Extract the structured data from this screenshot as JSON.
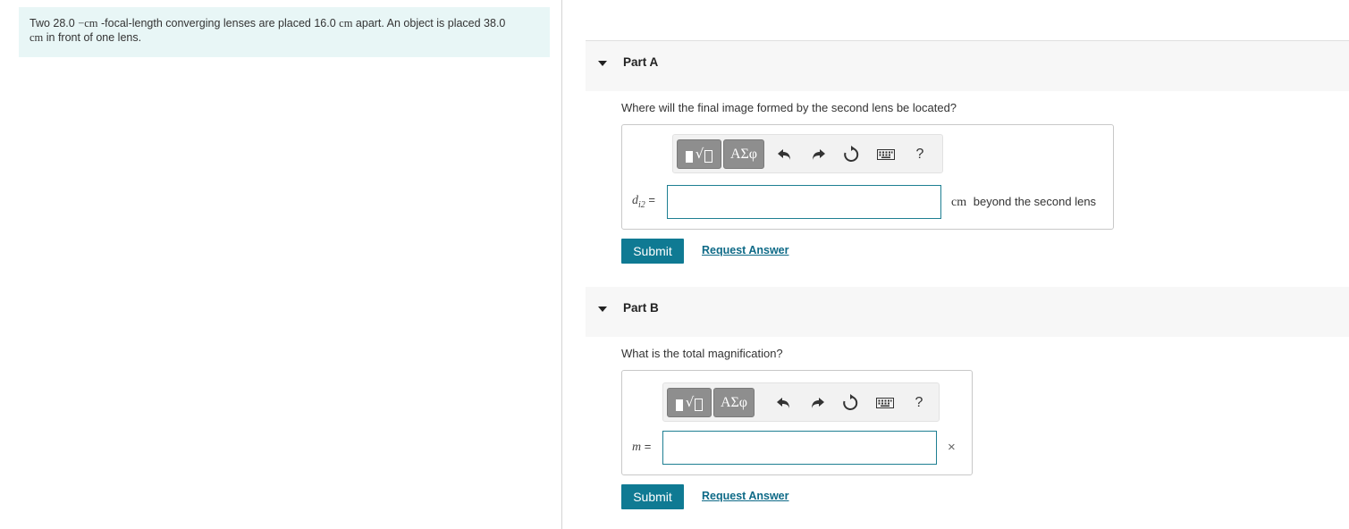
{
  "problem": {
    "text_a": "Two 28.0 ",
    "unit_minus_cm": "−cm",
    "text_b": " -focal-length converging lenses are placed 16.0 ",
    "unit_cm_1": "cm",
    "text_c": " apart. An object is placed 38.0 ",
    "unit_cm_2": "cm",
    "text_d": " in front of one lens."
  },
  "part_a": {
    "title": "Part A",
    "question": "Where will the final image formed by the second lens be located?",
    "var_name": "d",
    "var_sub": "i2",
    "equals": " =",
    "input_value": "",
    "unit": "cm",
    "unit_suffix": "beyond the second lens",
    "submit_label": "Submit",
    "request_label": "Request Answer"
  },
  "part_b": {
    "title": "Part B",
    "question": "What is the total magnification?",
    "var_name": "m",
    "equals": " =",
    "input_value": "",
    "clear_symbol": "×",
    "submit_label": "Submit",
    "request_label": "Request Answer"
  },
  "toolbar": {
    "greek_label": "ΑΣφ",
    "help_label": "?",
    "root_symbol": "√"
  },
  "colors": {
    "accent": "#0f7a93",
    "problem_bg": "#e8f6f6",
    "link": "#0e6a87"
  }
}
